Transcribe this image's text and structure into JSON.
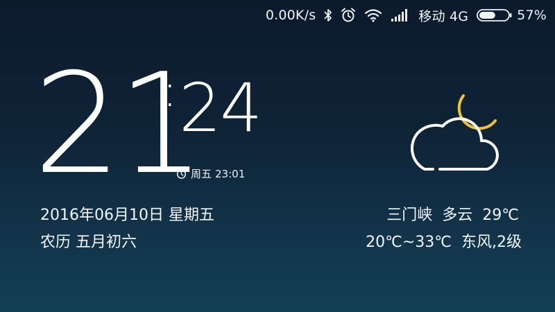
{
  "status_bar": {
    "network_speed": "0.00K/s",
    "carrier": "移动 4G",
    "battery_percent": "57%",
    "battery_level": 0.57,
    "icons": [
      "bluetooth-icon",
      "alarm-icon",
      "wifi-icon",
      "signal-icon",
      "battery-icon"
    ]
  },
  "clock": {
    "hours": "21",
    "colon": ":",
    "minutes": "24",
    "alarm": {
      "day": "周五",
      "time": "23:01"
    }
  },
  "date": {
    "gregorian": "2016年06月10日",
    "weekday": "星期五",
    "lunar_label": "农历",
    "lunar_date": "五月初六"
  },
  "weather": {
    "icon": "partly-cloudy-night-icon",
    "city": "三门峡",
    "condition": "多云",
    "current_temp": "29℃",
    "range": "20℃~33℃",
    "wind": "东风,2级"
  },
  "colors": {
    "moon": "#f2c230",
    "text": "#ffffff",
    "background_top": "#0c1a2c",
    "background_bottom": "#124052"
  }
}
